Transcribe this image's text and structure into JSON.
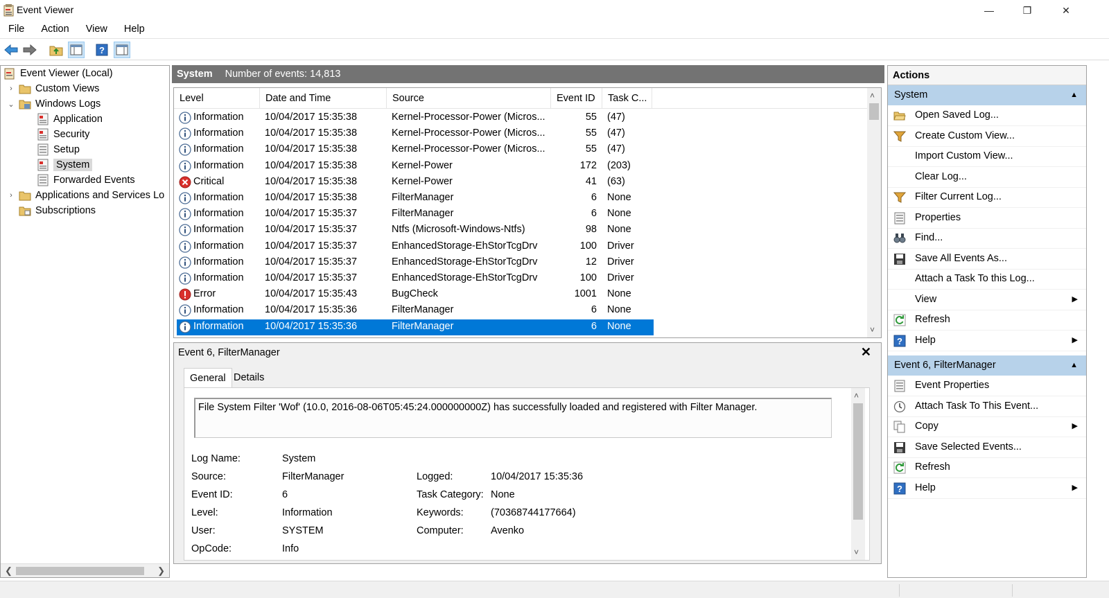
{
  "window": {
    "title": "Event Viewer",
    "minimize_glyph": "—",
    "restore_glyph": "❐",
    "close_glyph": "✕"
  },
  "menu": [
    "File",
    "Action",
    "View",
    "Help"
  ],
  "toolbar": {
    "icons": [
      "back-arrow-icon",
      "forward-arrow-icon",
      "folder-up-icon",
      "show-hide-console-tree-icon",
      "help-icon",
      "show-hide-action-pane-icon"
    ]
  },
  "tree": {
    "items": [
      {
        "label": "Event Viewer (Local)",
        "icon": "event-viewer-icon"
      },
      {
        "label": "Custom Views",
        "icon": "folder-icon",
        "expander": "›"
      },
      {
        "label": "Windows Logs",
        "icon": "folder-icon",
        "expander": "⌄"
      },
      {
        "label": "Application",
        "icon": "log-icon"
      },
      {
        "label": "Security",
        "icon": "log-icon"
      },
      {
        "label": "Setup",
        "icon": "log-icon"
      },
      {
        "label": "System",
        "icon": "log-icon"
      },
      {
        "label": "Forwarded Events",
        "icon": "log-icon"
      },
      {
        "label": "Applications and Services Lo",
        "icon": "folder-icon",
        "expander": "›"
      },
      {
        "label": "Subscriptions",
        "icon": "subscriptions-icon"
      }
    ],
    "selected": "System"
  },
  "center": {
    "log_name": "System",
    "event_count": "Number of events: 14,813"
  },
  "events": {
    "columns": [
      "Level",
      "Date and Time",
      "Source",
      "Event ID",
      "Task C..."
    ],
    "rows": [
      {
        "level": "Information",
        "icon": "info",
        "datetime": "10/04/2017 15:35:38",
        "source": "Kernel-Processor-Power (Micros...",
        "event_id": "55",
        "task": "(47)"
      },
      {
        "level": "Information",
        "icon": "info",
        "datetime": "10/04/2017 15:35:38",
        "source": "Kernel-Processor-Power (Micros...",
        "event_id": "55",
        "task": "(47)"
      },
      {
        "level": "Information",
        "icon": "info",
        "datetime": "10/04/2017 15:35:38",
        "source": "Kernel-Processor-Power (Micros...",
        "event_id": "55",
        "task": "(47)"
      },
      {
        "level": "Information",
        "icon": "info",
        "datetime": "10/04/2017 15:35:38",
        "source": "Kernel-Power",
        "event_id": "172",
        "task": "(203)"
      },
      {
        "level": "Critical",
        "icon": "critical",
        "datetime": "10/04/2017 15:35:38",
        "source": "Kernel-Power",
        "event_id": "41",
        "task": "(63)"
      },
      {
        "level": "Information",
        "icon": "info",
        "datetime": "10/04/2017 15:35:38",
        "source": "FilterManager",
        "event_id": "6",
        "task": "None"
      },
      {
        "level": "Information",
        "icon": "info",
        "datetime": "10/04/2017 15:35:37",
        "source": "FilterManager",
        "event_id": "6",
        "task": "None"
      },
      {
        "level": "Information",
        "icon": "info",
        "datetime": "10/04/2017 15:35:37",
        "source": "Ntfs (Microsoft-Windows-Ntfs)",
        "event_id": "98",
        "task": "None"
      },
      {
        "level": "Information",
        "icon": "info",
        "datetime": "10/04/2017 15:35:37",
        "source": "EnhancedStorage-EhStorTcgDrv",
        "event_id": "100",
        "task": "Driver"
      },
      {
        "level": "Information",
        "icon": "info",
        "datetime": "10/04/2017 15:35:37",
        "source": "EnhancedStorage-EhStorTcgDrv",
        "event_id": "12",
        "task": "Driver"
      },
      {
        "level": "Information",
        "icon": "info",
        "datetime": "10/04/2017 15:35:37",
        "source": "EnhancedStorage-EhStorTcgDrv",
        "event_id": "100",
        "task": "Driver"
      },
      {
        "level": "Error",
        "icon": "error",
        "datetime": "10/04/2017 15:35:43",
        "source": "BugCheck",
        "event_id": "1001",
        "task": "None"
      },
      {
        "level": "Information",
        "icon": "info",
        "datetime": "10/04/2017 15:35:36",
        "source": "FilterManager",
        "event_id": "6",
        "task": "None"
      },
      {
        "level": "Information",
        "icon": "info",
        "datetime": "10/04/2017 15:35:36",
        "source": "FilterManager",
        "event_id": "6",
        "task": "None",
        "selected": true
      }
    ]
  },
  "detail": {
    "title": "Event 6, FilterManager",
    "close_glyph": "✕",
    "tabs": [
      "General",
      "Details"
    ],
    "active_tab": "General",
    "message": "File System Filter 'Wof' (10.0, 2016-08-06T05:45:24.000000000Z) has successfully loaded and registered with Filter Manager.",
    "properties": {
      "log_name_label": "Log Name:",
      "log_name": "System",
      "source_label": "Source:",
      "source": "FilterManager",
      "logged_label": "Logged:",
      "logged": "10/04/2017 15:35:36",
      "event_id_label": "Event ID:",
      "event_id": "6",
      "task_category_label": "Task Category:",
      "task_category": "None",
      "level_label": "Level:",
      "level": "Information",
      "keywords_label": "Keywords:",
      "keywords": "(70368744177664)",
      "user_label": "User:",
      "user": "SYSTEM",
      "computer_label": "Computer:",
      "computer": "Avenko",
      "opcode_label": "OpCode:",
      "opcode": "Info"
    }
  },
  "actions": {
    "title": "Actions",
    "sections": [
      {
        "header": "System",
        "items": [
          {
            "label": "Open Saved Log...",
            "icon": "open-folder-icon"
          },
          {
            "label": "Create Custom View...",
            "icon": "filter-icon"
          },
          {
            "label": "Import Custom View...",
            "icon": ""
          },
          {
            "label": "Clear Log...",
            "icon": ""
          },
          {
            "label": "Filter Current Log...",
            "icon": "filter-icon"
          },
          {
            "label": "Properties",
            "icon": "properties-icon"
          },
          {
            "label": "Find...",
            "icon": "binoculars-icon"
          },
          {
            "label": "Save All Events As...",
            "icon": "save-icon"
          },
          {
            "label": "Attach a Task To this Log...",
            "icon": ""
          },
          {
            "label": "View",
            "icon": "",
            "submenu": true
          },
          {
            "label": "Refresh",
            "icon": "refresh-icon"
          },
          {
            "label": "Help",
            "icon": "help-icon",
            "submenu": true
          }
        ]
      },
      {
        "header": "Event 6, FilterManager",
        "items": [
          {
            "label": "Event Properties",
            "icon": "properties-icon"
          },
          {
            "label": "Attach Task To This Event...",
            "icon": "task-clock-icon"
          },
          {
            "label": "Copy",
            "icon": "copy-icon",
            "submenu": true
          },
          {
            "label": "Save Selected Events...",
            "icon": "save-icon"
          },
          {
            "label": "Refresh",
            "icon": "refresh-icon"
          },
          {
            "label": "Help",
            "icon": "help-icon",
            "submenu": true
          }
        ]
      }
    ]
  },
  "colors": {
    "selection": "#0078d7",
    "section_header": "#b7d2ea",
    "center_header": "#737373",
    "critical": "#d9302c",
    "info": "#3a6ea5"
  }
}
